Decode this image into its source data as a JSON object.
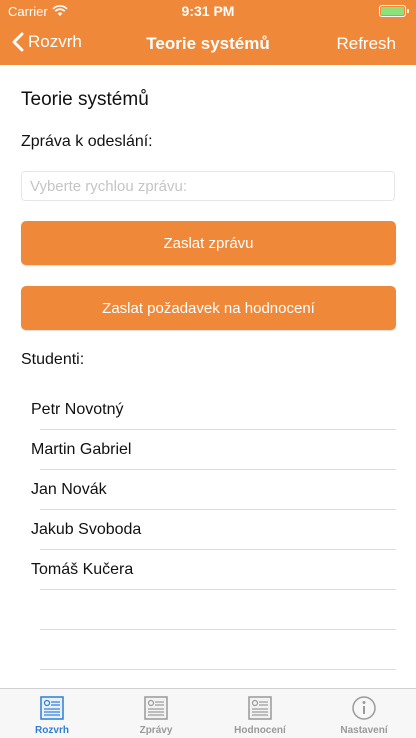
{
  "status_bar": {
    "carrier": "Carrier",
    "time": "9:31 PM"
  },
  "nav": {
    "back_label": "Rozvrh",
    "title": "Teorie systémů",
    "refresh_label": "Refresh"
  },
  "main": {
    "course_title": "Teorie systémů",
    "message_label": "Zpráva k odeslání:",
    "quick_message_placeholder": "Vyberte rychlou zprávu:",
    "send_button": "Zaslat zprávu",
    "rating_button": "Zaslat požadavek na hodnocení",
    "students_label": "Studenti:"
  },
  "students": [
    "Petr Novotný",
    "Martin Gabriel",
    "Jan Novák",
    "Jakub Svoboda",
    "Tomáš Kučera"
  ],
  "tabs": [
    {
      "label": "Rozvrh",
      "icon": "schedule-icon",
      "active": true
    },
    {
      "label": "Zprávy",
      "icon": "messages-icon",
      "active": false
    },
    {
      "label": "Hodnocení",
      "icon": "rating-icon",
      "active": false
    },
    {
      "label": "Nastavení",
      "icon": "info-icon",
      "active": false
    }
  ],
  "colors": {
    "accent": "#f0883a",
    "tab_active": "#2d7fd6",
    "tab_inactive": "#9a9a9a"
  }
}
